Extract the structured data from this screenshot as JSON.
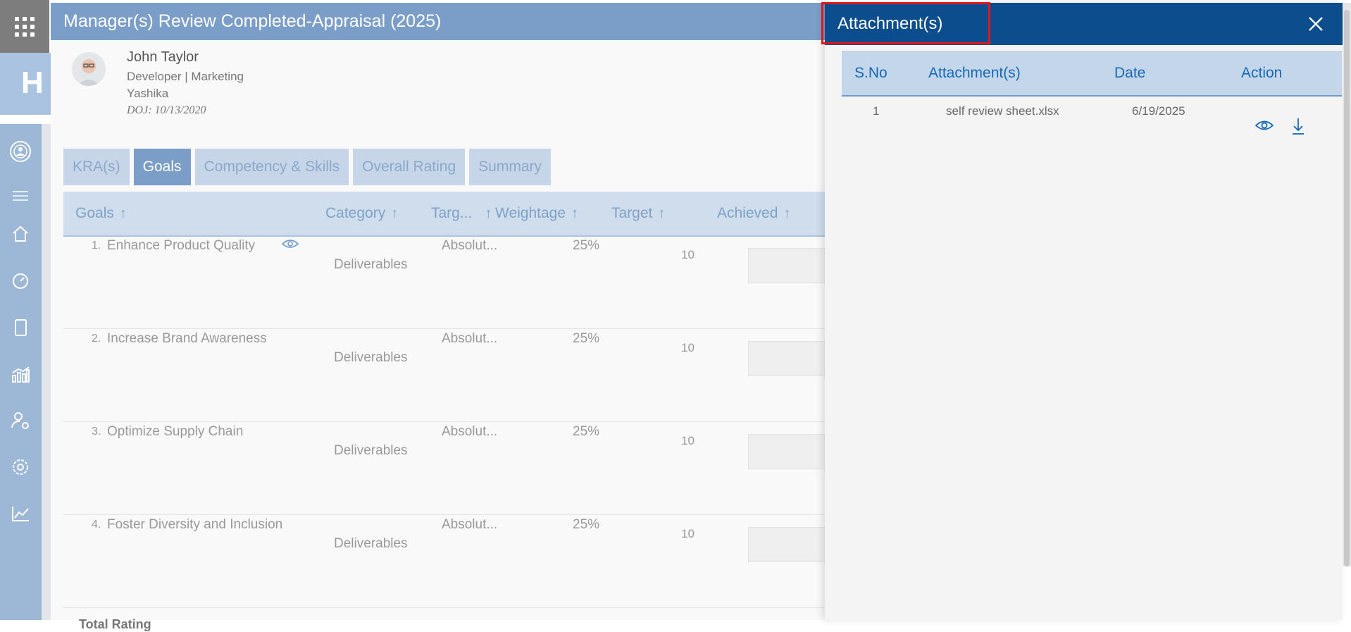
{
  "app": {
    "behind_header_text": "H"
  },
  "panel": {
    "title": "Manager(s) Review Completed-Appraisal (2025)",
    "employee": {
      "name": "John Taylor",
      "role": "Developer | Marketing",
      "manager": "Yashika",
      "doj": "DOJ: 10/13/2020"
    },
    "tabs": [
      {
        "label": "KRA(s)",
        "active": false
      },
      {
        "label": "Goals",
        "active": true
      },
      {
        "label": "Competency & Skills",
        "active": false
      },
      {
        "label": "Overall Rating",
        "active": false
      },
      {
        "label": "Summary",
        "active": false
      }
    ],
    "columns": {
      "goals": "Goals",
      "category": "Category",
      "target_type": "Targ...",
      "weightage": "Weightage",
      "target": "Target",
      "achieved": "Achieved",
      "sort_arrow": "↑"
    },
    "rows": [
      {
        "index": "1.",
        "goal": "Enhance Product Quality",
        "category": "Deliverables",
        "target_type": "Absolut...",
        "weightage": "25%",
        "target": "10"
      },
      {
        "index": "2.",
        "goal": "Increase Brand Awareness",
        "category": "Deliverables",
        "target_type": "Absolut...",
        "weightage": "25%",
        "target": "10"
      },
      {
        "index": "3.",
        "goal": "Optimize Supply Chain",
        "category": "Deliverables",
        "target_type": "Absolut...",
        "weightage": "25%",
        "target": "10"
      },
      {
        "index": "4.",
        "goal": "Foster Diversity and Inclusion",
        "category": "Deliverables",
        "target_type": "Absolut...",
        "weightage": "25%",
        "target": "10"
      }
    ],
    "footer_label": "Total Rating"
  },
  "attachments": {
    "title": "Attachment(s)",
    "columns": {
      "sno": "S.No",
      "name": "Attachment(s)",
      "date": "Date",
      "action": "Action"
    },
    "rows": [
      {
        "sno": "1",
        "name": "self review sheet.xlsx",
        "date": "6/19/2025"
      }
    ]
  },
  "colors": {
    "panel_header": "#7a9ec8",
    "attachment_header": "#0c4e8d",
    "highlight": "#e0161f",
    "link_blue": "#1769b8"
  }
}
